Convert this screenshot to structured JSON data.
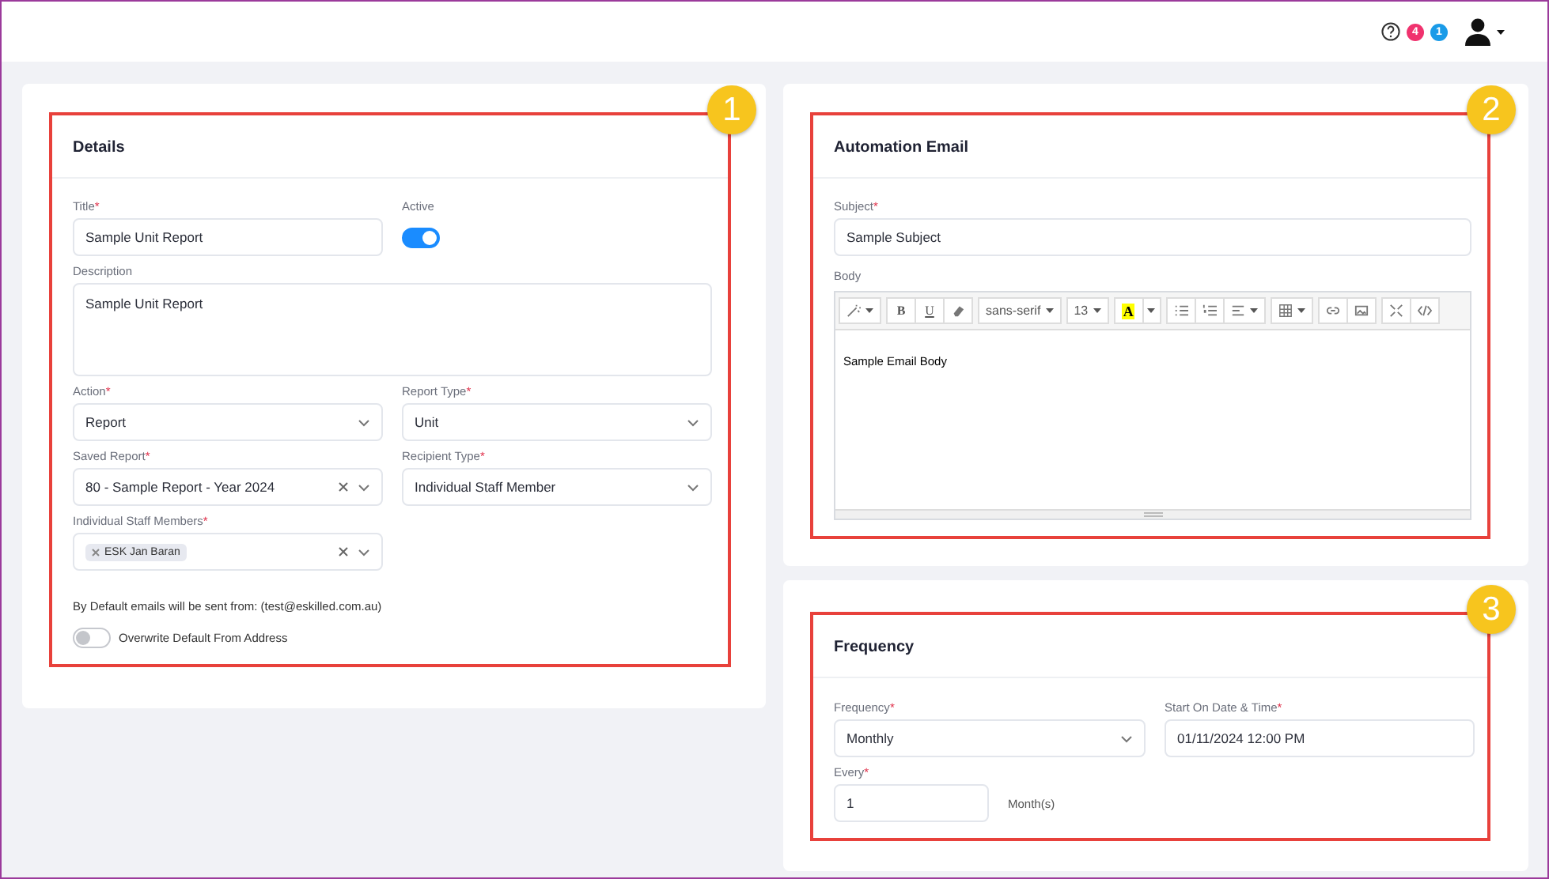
{
  "header": {
    "notifications": [
      {
        "count": "4",
        "color": "#f0326e"
      },
      {
        "count": "1",
        "color": "#1a9be8"
      }
    ]
  },
  "details": {
    "callout": "1",
    "title": "Details",
    "title_field": {
      "label": "Title",
      "required": "*",
      "value": "Sample Unit Report"
    },
    "active": {
      "label": "Active",
      "on": true
    },
    "description": {
      "label": "Description",
      "value": "Sample Unit Report"
    },
    "selects": [
      {
        "label": "Action",
        "required": "*",
        "value": "Report",
        "clearable": false
      },
      {
        "label": "Report Type",
        "required": "*",
        "value": "Unit",
        "clearable": false
      },
      {
        "label": "Saved Report",
        "required": "*",
        "value": "80 - Sample Report - Year 2024",
        "clearable": true
      },
      {
        "label": "Recipient Type",
        "required": "*",
        "value": "Individual Staff Member",
        "clearable": false
      }
    ],
    "staff": {
      "label": "Individual Staff Members",
      "required": "*",
      "tags": [
        "ESK Jan Baran"
      ],
      "clearable": true
    },
    "note": "By Default emails will be sent from: (test@eskilled.com.au)",
    "overwrite": {
      "label": "Overwrite Default From Address",
      "on": false
    }
  },
  "automation_email": {
    "callout": "2",
    "title": "Automation Email",
    "subject": {
      "label": "Subject",
      "required": "*",
      "value": "Sample Subject"
    },
    "body_label": "Body",
    "toolbar": [
      [
        {
          "kind": "magic",
          "caret": true
        }
      ],
      [
        {
          "kind": "bold",
          "label": "B"
        },
        {
          "kind": "underline",
          "label": "U"
        },
        {
          "kind": "eraser"
        }
      ],
      [
        {
          "kind": "font",
          "label": "sans-serif",
          "caret": true
        }
      ],
      [
        {
          "kind": "size",
          "label": "13",
          "caret": true
        }
      ],
      [
        {
          "kind": "color",
          "label": "A"
        },
        {
          "kind": "caret-only",
          "caret": true
        }
      ],
      [
        {
          "kind": "ul"
        },
        {
          "kind": "ol"
        },
        {
          "kind": "align",
          "caret": true
        }
      ],
      [
        {
          "kind": "table",
          "caret": true
        }
      ],
      [
        {
          "kind": "link"
        },
        {
          "kind": "image"
        }
      ],
      [
        {
          "kind": "fullscreen"
        },
        {
          "kind": "code"
        }
      ]
    ],
    "body": "Sample Email Body"
  },
  "frequency": {
    "callout": "3",
    "title": "Frequency",
    "frequency_select": {
      "label": "Frequency",
      "required": "*",
      "value": "Monthly",
      "clearable": false
    },
    "start": {
      "label": "Start On Date & Time",
      "required": "*",
      "value": "01/11/2024 12:00 PM"
    },
    "every": {
      "label": "Every",
      "required": "*",
      "value": "1"
    },
    "unit": "Month(s)"
  }
}
